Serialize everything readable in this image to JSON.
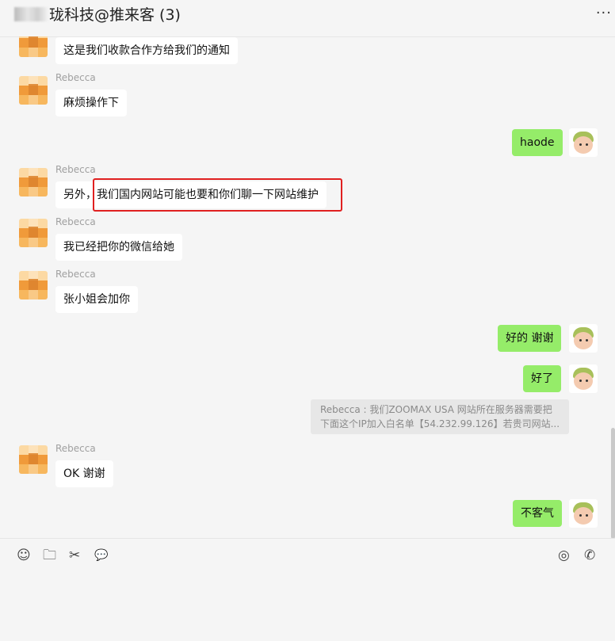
{
  "header": {
    "title": "珑科技@推来客 (3)",
    "more": "···"
  },
  "messages": {
    "m1": {
      "text": "这是我们收款合作方给我们的通知"
    },
    "m2": {
      "sender": "Rebecca",
      "text": "麻烦操作下"
    },
    "m3": {
      "text": "haode"
    },
    "m4": {
      "sender": "Rebecca",
      "text": "另外，我们国内网站可能也要和你们聊一下网站维护"
    },
    "m5": {
      "sender": "Rebecca",
      "text": "我已经把你的微信给她"
    },
    "m6": {
      "sender": "Rebecca",
      "text": "张小姐会加你"
    },
    "m7": {
      "text": "好的 谢谢"
    },
    "m8": {
      "text": "好了"
    },
    "quote": {
      "line1": "Rebecca : 我们ZOOMAX USA 网站所在服务器需要把",
      "line2": "下面这个IP加入白名单【54.232.99.126】若贵司网站..."
    },
    "m9": {
      "sender": "Rebecca",
      "text": "OK 谢谢"
    },
    "m10": {
      "text": "不客气"
    }
  },
  "toolbar": {
    "emoji": "☺",
    "folder": "🗀",
    "scissors": "✂",
    "chat": "💬",
    "live": "◎",
    "call": "✆"
  }
}
